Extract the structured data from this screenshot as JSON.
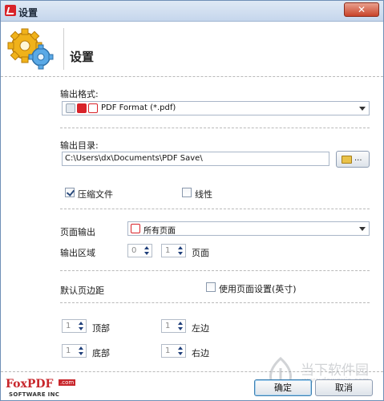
{
  "window": {
    "title": "设置",
    "close_glyph": "✕"
  },
  "header": {
    "page_title": "设置",
    "icon": "gears-icon"
  },
  "output_format": {
    "label": "输出格式:",
    "selected": "PDF Format (*.pdf)"
  },
  "output_dir": {
    "label": "输出目录:",
    "value": "C:\\Users\\dx\\Documents\\PDF Save\\",
    "browse_label": "..."
  },
  "options": {
    "compress_label": "压缩文件",
    "compress_checked": true,
    "linear_label": "线性",
    "linear_checked": false
  },
  "page_output": {
    "label": "页面输出",
    "selected": "所有页面"
  },
  "output_range": {
    "label": "输出区域",
    "from": "0",
    "to": "1",
    "unit": "页面"
  },
  "margins": {
    "label": "默认页边距",
    "use_page_setup_label": "使用页面设置(英寸)",
    "use_page_setup_checked": false,
    "top_label": "顶部",
    "top_value": "1",
    "left_label": "左边",
    "left_value": "1",
    "bottom_label": "底部",
    "bottom_value": "1",
    "right_label": "右边",
    "right_value": "1"
  },
  "footer": {
    "logo_main": "FoxPDF",
    "logo_com": ".com",
    "logo_sub": "SOFTWARE INC",
    "ok_label": "确定",
    "cancel_label": "取消"
  },
  "watermark": {
    "text": "当下软件园",
    "url": "www.downxia.com"
  },
  "colors": {
    "accent_red": "#c8262b",
    "border_blue": "#6f8fb6"
  }
}
